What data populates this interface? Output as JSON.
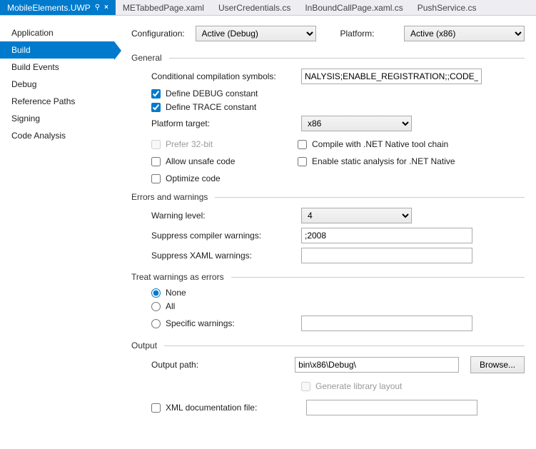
{
  "tabs": [
    {
      "label": "MobileElements.UWP",
      "active": true,
      "pinned": true,
      "closable": true
    },
    {
      "label": "METabbedPage.xaml"
    },
    {
      "label": "UserCredentials.cs"
    },
    {
      "label": "InBoundCallPage.xaml.cs"
    },
    {
      "label": "PushService.cs"
    }
  ],
  "sidebar": {
    "items": [
      "Application",
      "Build",
      "Build Events",
      "Debug",
      "Reference Paths",
      "Signing",
      "Code Analysis"
    ],
    "activeIndex": 1
  },
  "config": {
    "configuration_label": "Configuration:",
    "configuration_value": "Active (Debug)",
    "platform_label": "Platform:",
    "platform_value": "Active (x86)"
  },
  "sections": {
    "general": {
      "title": "General",
      "cond_label": "Conditional compilation symbols:",
      "cond_value": "NALYSIS;ENABLE_REGISTRATION;;CODE_ANALYSIS",
      "debug_const": "Define DEBUG constant",
      "trace_const": "Define TRACE constant",
      "platform_target_label": "Platform target:",
      "platform_target_value": "x86",
      "prefer32": "Prefer 32-bit",
      "compile_native": "Compile with .NET Native tool chain",
      "allow_unsafe": "Allow unsafe code",
      "enable_static": "Enable static analysis for .NET Native",
      "optimize": "Optimize code"
    },
    "errors": {
      "title": "Errors and warnings",
      "warning_level_label": "Warning level:",
      "warning_level_value": "4",
      "suppress_compiler_label": "Suppress compiler warnings:",
      "suppress_compiler_value": ";2008",
      "suppress_xaml_label": "Suppress XAML warnings:",
      "suppress_xaml_value": ""
    },
    "treat": {
      "title": "Treat warnings as errors",
      "none": "None",
      "all": "All",
      "specific": "Specific warnings:",
      "specific_value": ""
    },
    "output": {
      "title": "Output",
      "path_label": "Output path:",
      "path_value": "bin\\x86\\Debug\\",
      "browse": "Browse...",
      "genlib": "Generate library layout",
      "xmldoc": "XML documentation file:",
      "xmldoc_value": ""
    }
  }
}
